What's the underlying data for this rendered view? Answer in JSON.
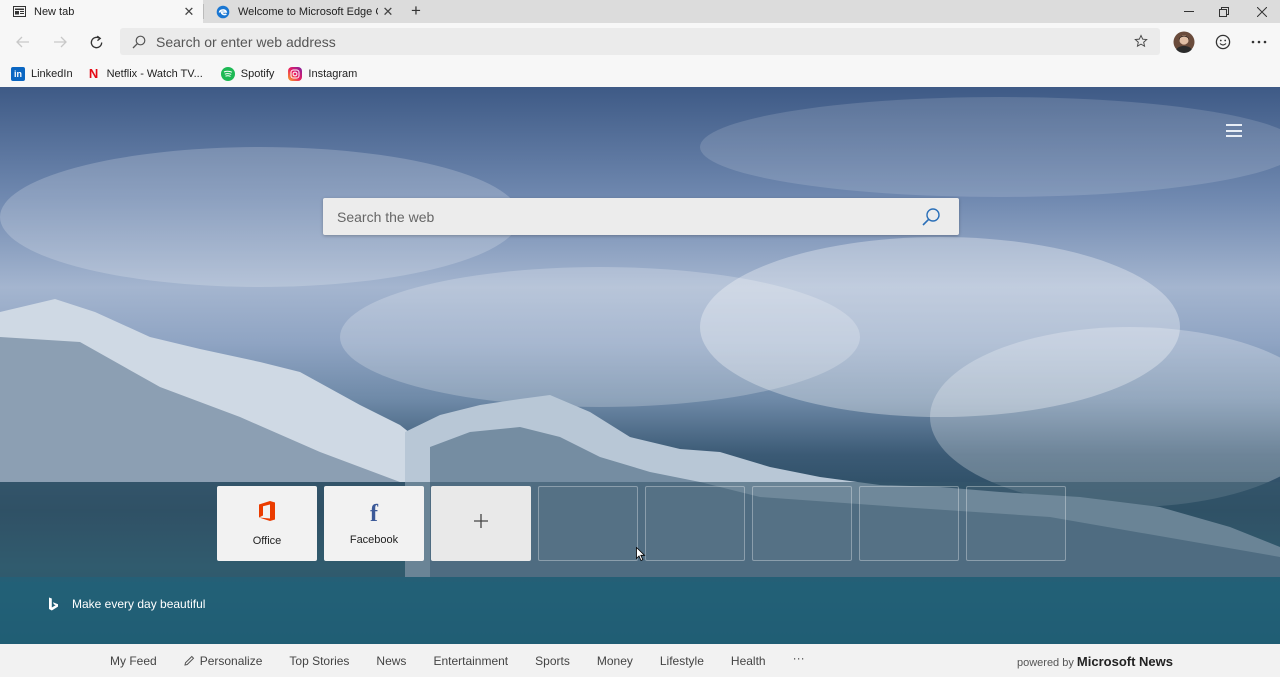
{
  "tabs": [
    {
      "title": "New tab",
      "icon": "newtab-icon"
    },
    {
      "title": "Welcome to Microsoft Edge Can",
      "icon": "edge-icon"
    }
  ],
  "toolbar": {
    "address_placeholder": "Search or enter web address"
  },
  "favorites": [
    {
      "label": "LinkedIn",
      "icon": "linkedin-icon",
      "color": "#0a66c2"
    },
    {
      "label": "Netflix - Watch TV...",
      "icon": "netflix-icon",
      "color": "#e50914"
    },
    {
      "label": "Spotify",
      "icon": "spotify-icon",
      "color": "#1db954"
    },
    {
      "label": "Instagram",
      "icon": "instagram-icon",
      "color": "#d6249f"
    }
  ],
  "newtab": {
    "search_placeholder": "Search the web",
    "tiles": [
      {
        "label": "Office",
        "icon": "office-icon"
      },
      {
        "label": "Facebook",
        "icon": "facebook-icon"
      },
      {
        "label": "",
        "icon": "plus-icon"
      }
    ],
    "tagline": "Make every day beautiful"
  },
  "news": {
    "items": [
      "My Feed",
      "Personalize",
      "Top Stories",
      "News",
      "Entertainment",
      "Sports",
      "Money",
      "Lifestyle",
      "Health"
    ],
    "more": "···",
    "powered_prefix": "powered by",
    "powered_brand": "Microsoft News"
  }
}
